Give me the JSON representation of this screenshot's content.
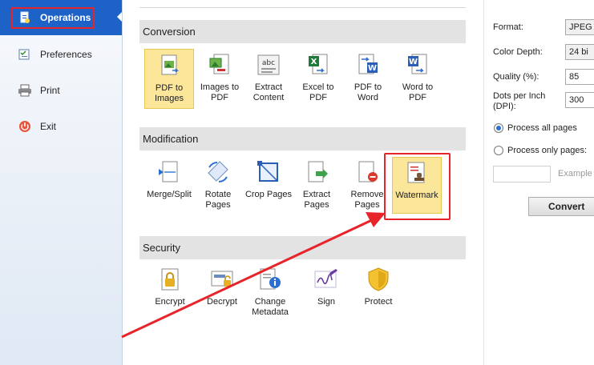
{
  "sidebar": {
    "items": [
      {
        "label": "Operations",
        "icon": "document-icon"
      },
      {
        "label": "Preferences",
        "icon": "checklist-icon"
      },
      {
        "label": "Print",
        "icon": "printer-icon"
      },
      {
        "label": "Exit",
        "icon": "power-icon"
      }
    ]
  },
  "sections": {
    "conversion": "Conversion",
    "modification": "Modification",
    "security": "Security"
  },
  "conversion_tools": [
    "PDF to Images",
    "Images to PDF",
    "Extract Content",
    "Excel to PDF",
    "PDF to Word",
    "Word to PDF"
  ],
  "modification_tools": [
    "Merge/Split",
    "Rotate Pages",
    "Crop Pages",
    "Extract Pages",
    "Remove Pages",
    "Watermark"
  ],
  "security_tools": [
    "Encrypt",
    "Decrypt",
    "Change Metadata",
    "Sign",
    "Protect"
  ],
  "options": {
    "format_label": "Format:",
    "format_value": "JPEG",
    "color_depth_label": "Color Depth:",
    "color_depth_value": "24 bi",
    "quality_label": "Quality (%):",
    "quality_value": "85",
    "dpi_label": "Dots per Inch (DPI):",
    "dpi_value": "300",
    "process_all": "Process all pages",
    "process_only": "Process only pages:",
    "example": "Example",
    "convert": "Convert"
  },
  "colors": {
    "accent": "#1d63c7",
    "highlight": "#e8242b",
    "selected_tool": "#fbe69a"
  }
}
